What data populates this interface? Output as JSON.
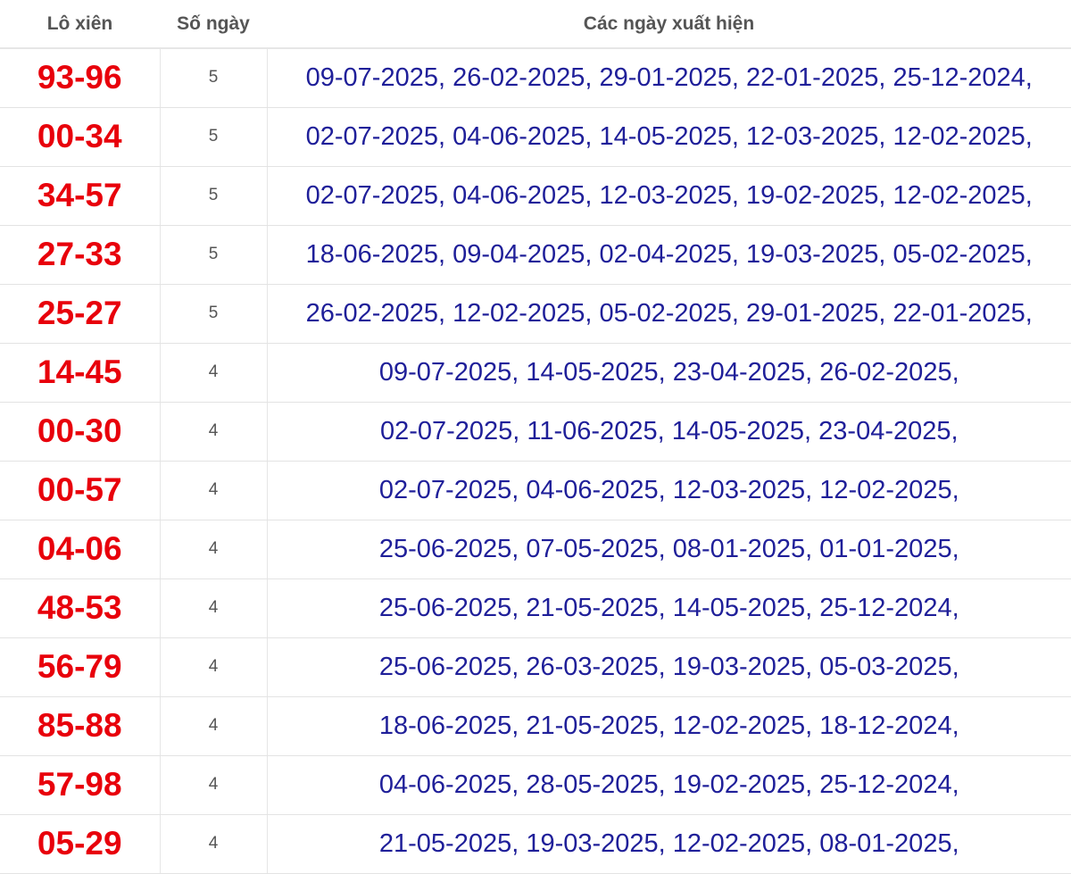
{
  "table": {
    "headers": {
      "pair": "Lô xiên",
      "days": "Số ngày",
      "dates": "Các ngày xuất hiện"
    },
    "rows": [
      {
        "pair": "93-96",
        "days": "5",
        "dates": "09-07-2025, 26-02-2025, 29-01-2025, 22-01-2025, 25-12-2024,"
      },
      {
        "pair": "00-34",
        "days": "5",
        "dates": "02-07-2025, 04-06-2025, 14-05-2025, 12-03-2025, 12-02-2025,"
      },
      {
        "pair": "34-57",
        "days": "5",
        "dates": "02-07-2025, 04-06-2025, 12-03-2025, 19-02-2025, 12-02-2025,"
      },
      {
        "pair": "27-33",
        "days": "5",
        "dates": "18-06-2025, 09-04-2025, 02-04-2025, 19-03-2025, 05-02-2025,"
      },
      {
        "pair": "25-27",
        "days": "5",
        "dates": "26-02-2025, 12-02-2025, 05-02-2025, 29-01-2025, 22-01-2025,"
      },
      {
        "pair": "14-45",
        "days": "4",
        "dates": "09-07-2025, 14-05-2025, 23-04-2025, 26-02-2025,"
      },
      {
        "pair": "00-30",
        "days": "4",
        "dates": "02-07-2025, 11-06-2025, 14-05-2025, 23-04-2025,"
      },
      {
        "pair": "00-57",
        "days": "4",
        "dates": "02-07-2025, 04-06-2025, 12-03-2025, 12-02-2025,"
      },
      {
        "pair": "04-06",
        "days": "4",
        "dates": "25-06-2025, 07-05-2025, 08-01-2025, 01-01-2025,"
      },
      {
        "pair": "48-53",
        "days": "4",
        "dates": "25-06-2025, 21-05-2025, 14-05-2025, 25-12-2024,"
      },
      {
        "pair": "56-79",
        "days": "4",
        "dates": "25-06-2025, 26-03-2025, 19-03-2025, 05-03-2025,"
      },
      {
        "pair": "85-88",
        "days": "4",
        "dates": "18-06-2025, 21-05-2025, 12-02-2025, 18-12-2024,"
      },
      {
        "pair": "57-98",
        "days": "4",
        "dates": "04-06-2025, 28-05-2025, 19-02-2025, 25-12-2024,"
      },
      {
        "pair": "05-29",
        "days": "4",
        "dates": "21-05-2025, 19-03-2025, 12-02-2025, 08-01-2025,"
      }
    ]
  },
  "colors": {
    "pair_text": "#e8000b",
    "dates_text": "#1f1f99",
    "header_text": "#555555",
    "border": "#e3e3e3"
  }
}
